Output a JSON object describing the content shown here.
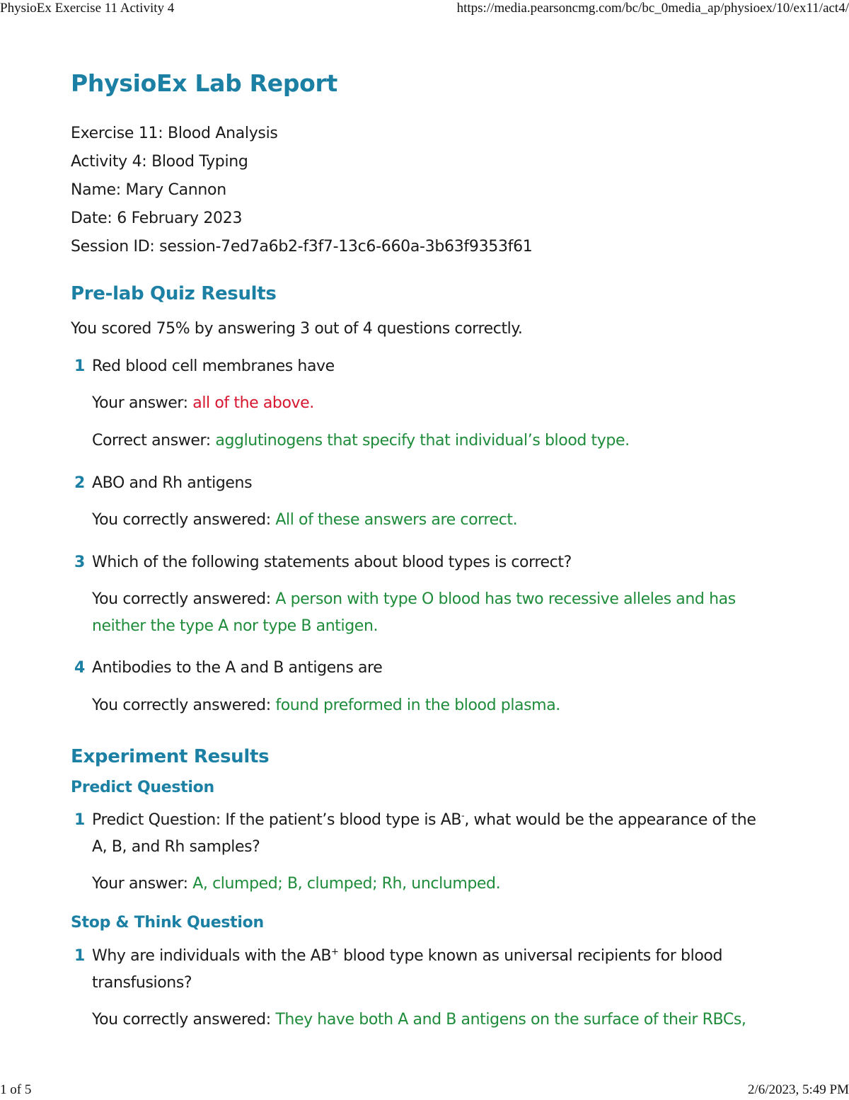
{
  "print_header": {
    "title": "PhysioEx Exercise 11 Activity 4",
    "url": "https://media.pearsoncmg.com/bc/bc_0media_ap/physioex/10/ex11/act4/"
  },
  "print_footer": {
    "page": "1 of 5",
    "datetime": "2/6/2023, 5:49 PM"
  },
  "report": {
    "title": "PhysioEx Lab Report",
    "exercise": "Exercise 11: Blood Analysis",
    "activity": "Activity 4: Blood Typing",
    "name": "Name: Mary Cannon",
    "date": "Date: 6 February 2023",
    "session": "Session ID: session-7ed7a6b2-f3f7-13c6-660a-3b63f9353f61"
  },
  "prelab": {
    "heading": "Pre-lab Quiz Results",
    "score_text": "You scored 75% by answering 3 out of 4 questions correctly.",
    "questions": [
      {
        "num": "1",
        "question": "Red blood cell membranes have",
        "answer_label": "Your answer: ",
        "answer": "all of the above.",
        "correct_label": "Correct answer: ",
        "correct": "agglutinogens that specify that individual’s blood type."
      },
      {
        "num": "2",
        "question": "ABO and Rh antigens",
        "answer_label": "You correctly answered: ",
        "answer": "All of these answers are correct."
      },
      {
        "num": "3",
        "question": "Which of the following statements about blood types is correct?",
        "answer_label": "You correctly answered: ",
        "answer_line1": "A person with type O blood has two recessive alleles and has",
        "answer_line2": "neither the type A nor type B antigen."
      },
      {
        "num": "4",
        "question": "Antibodies to the A and B antigens are",
        "answer_label": "You correctly answered: ",
        "answer": "found preformed in the blood plasma."
      }
    ]
  },
  "experiment": {
    "heading": "Experiment Results",
    "predict": {
      "heading": "Predict Question",
      "num": "1",
      "question_pre": "Predict Question: If the patient’s blood type is AB",
      "question_sup": "-",
      "question_post": ", what would be the appearance of the",
      "question_line2": "A, B, and Rh samples?",
      "answer_label": "Your answer: ",
      "answer": "A, clumped; B, clumped; Rh, unclumped."
    },
    "stop_think": {
      "heading": "Stop & Think Question",
      "num": "1",
      "question_pre": "Why are individuals with the AB",
      "question_sup": "+",
      "question_post": " blood type known as universal recipients for blood",
      "question_line2": "transfusions?",
      "answer_label": "You correctly answered: ",
      "answer": "They have both A and B antigens on the surface of their RBCs,"
    }
  },
  "colors": {
    "heading": "#1b80a3",
    "wrong": "#d7152e",
    "correct": "#1e8c3a"
  }
}
